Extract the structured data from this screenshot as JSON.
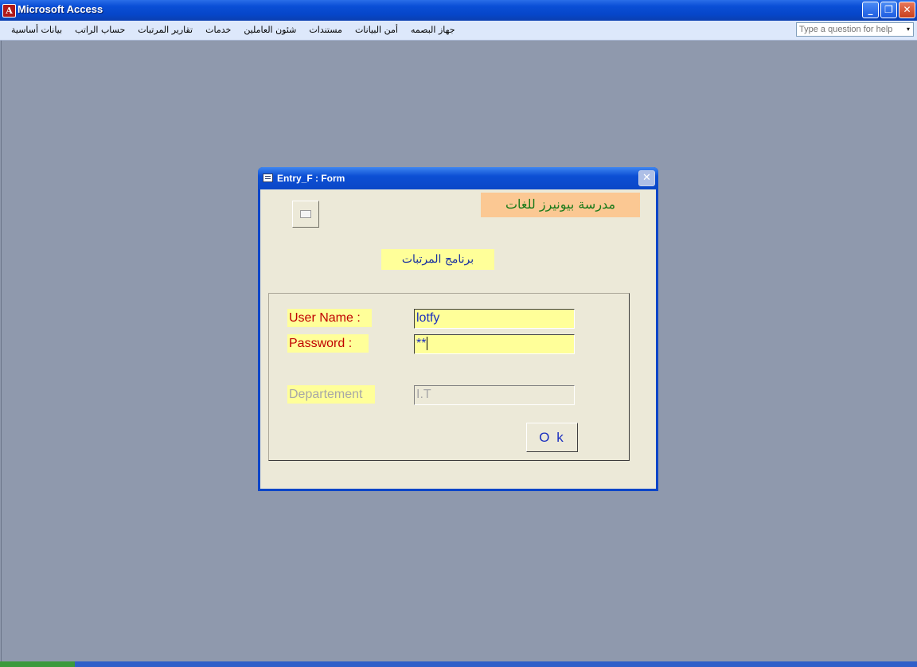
{
  "app": {
    "title": "Microsoft Access",
    "icon_glyph": "A",
    "window_buttons": {
      "minimize": "_",
      "restore": "❐",
      "close": "✕"
    }
  },
  "menu": {
    "items": [
      {
        "label": "بيانات أساسية"
      },
      {
        "label": "حساب الراتب"
      },
      {
        "label": "تقارير المرتبات"
      },
      {
        "label": "خدمات"
      },
      {
        "label": "شئون العاملين"
      },
      {
        "label": "مستندات"
      },
      {
        "label": "أمن البيانات"
      },
      {
        "label": "جهاز البصمه"
      }
    ],
    "help_placeholder": "Type a question for help",
    "help_dropdown": "▾"
  },
  "form": {
    "title": "Entry_F : Form",
    "close": "✕",
    "school_label": "مدرسة بيونيرز للغات",
    "program_label": "برنامج المرتبات",
    "user_label": "User Name :",
    "user_value": "lotfy",
    "password_label": "Password :",
    "password_value": "**",
    "department_label": "Departement",
    "department_value": "I.T",
    "ok_label": "O k"
  },
  "colors": {
    "workspace_bg": "#8f99ad",
    "field_highlight": "#ffff99",
    "label_text": "#c00000",
    "school_label_bg": "#fbc893"
  }
}
